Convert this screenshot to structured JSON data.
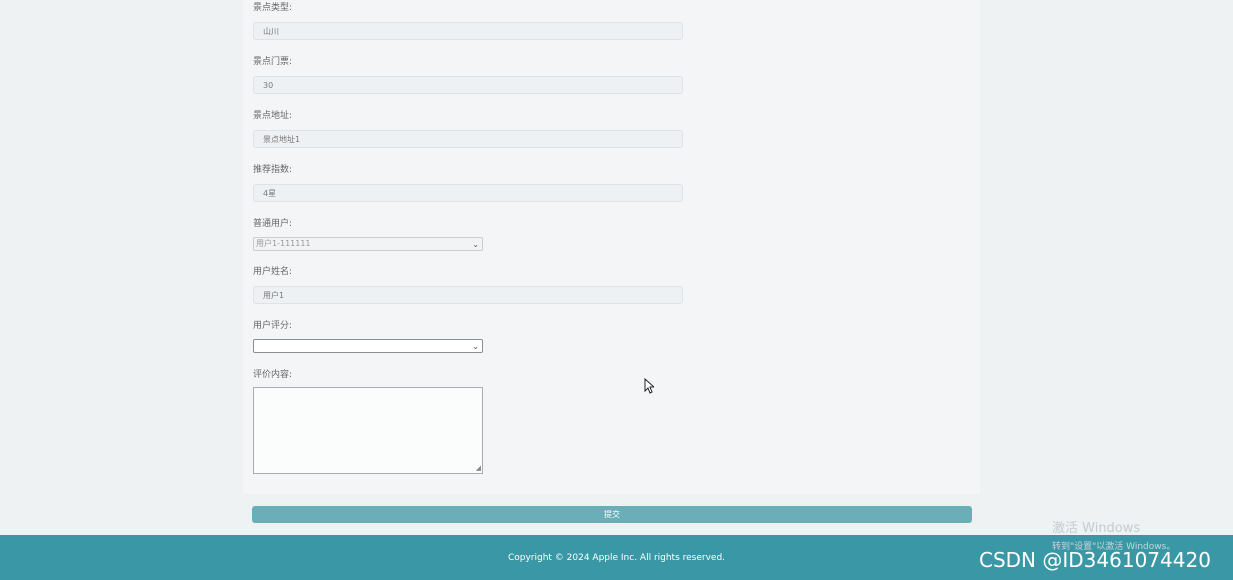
{
  "form": {
    "fields": [
      {
        "label": "景点类型:",
        "value": "山川"
      },
      {
        "label": "景点门票:",
        "value": "30"
      },
      {
        "label": "景点地址:",
        "value": "景点地址1"
      },
      {
        "label": "推荐指数:",
        "value": "4星"
      }
    ],
    "user_select": {
      "label": "普通用户:",
      "value": "用户1-111111"
    },
    "user_name": {
      "label": "用户姓名:",
      "value": "用户1"
    },
    "rating": {
      "label": "用户评分:",
      "value": ""
    },
    "review": {
      "label": "评价内容:",
      "value": ""
    },
    "submit_label": "提交"
  },
  "footer": {
    "copyright": "Copyright © 2024 Apple Inc. All rights reserved."
  },
  "overlay": {
    "activate_title": "激活 Windows",
    "activate_sub": "转到\"设置\"以激活 Windows。",
    "watermark": "CSDN @ID3461074420"
  },
  "colors": {
    "accent": "#3a98a6",
    "button": "#6aafb7"
  }
}
